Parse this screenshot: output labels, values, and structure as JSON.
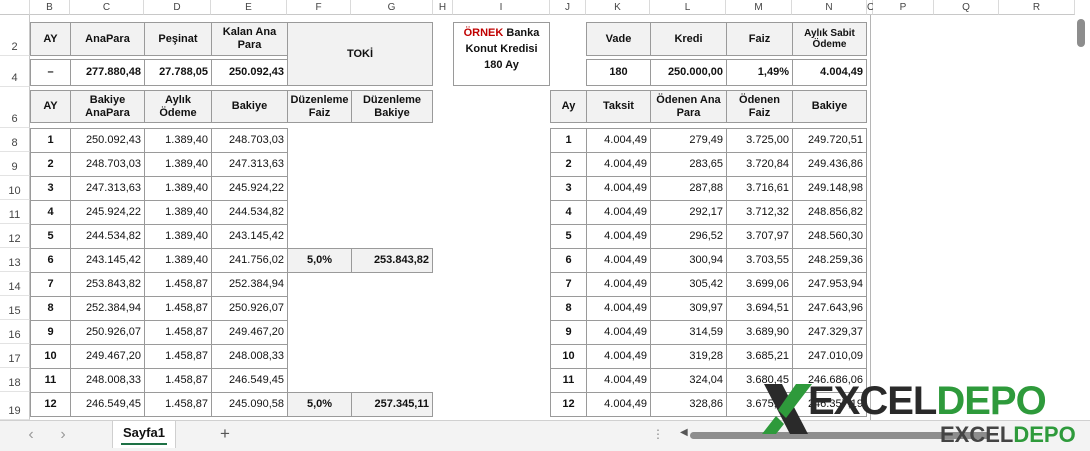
{
  "columns": [
    "B",
    "C",
    "D",
    "E",
    "F",
    "G",
    "H",
    "I",
    "J",
    "K",
    "L",
    "M",
    "N",
    "O",
    "P",
    "Q",
    "R"
  ],
  "rows": [
    "2",
    "4",
    "6",
    "8",
    "9",
    "10",
    "11",
    "12",
    "13",
    "14",
    "15",
    "16",
    "17",
    "18",
    "19"
  ],
  "left_summary": {
    "headers": [
      "AY",
      "AnaPara",
      "Peşinat",
      "Kalan Ana Para"
    ],
    "values": [
      "–",
      "277.880,48",
      "27.788,05",
      "250.092,43"
    ],
    "toki_label": "TOKİ"
  },
  "ornek": {
    "red": "ÖRNEK",
    "line1_rest": "Banka",
    "line2": "Konut Kredisi",
    "line3": "180 Ay"
  },
  "right_summary": {
    "headers": [
      "Vade",
      "Kredi",
      "Faiz",
      "Aylık Sabit Ödeme"
    ],
    "values": [
      "180",
      "250.000,00",
      "1,49%",
      "4.004,49"
    ]
  },
  "left_table": {
    "headers": [
      "AY",
      "Bakiye AnaPara",
      "Aylık Ödeme",
      "Bakiye",
      "Düzenleme Faiz",
      "Düzenleme Bakiye"
    ],
    "rows": [
      [
        "1",
        "250.092,43",
        "1.389,40",
        "248.703,03",
        "",
        ""
      ],
      [
        "2",
        "248.703,03",
        "1.389,40",
        "247.313,63",
        "",
        ""
      ],
      [
        "3",
        "247.313,63",
        "1.389,40",
        "245.924,22",
        "",
        ""
      ],
      [
        "4",
        "245.924,22",
        "1.389,40",
        "244.534,82",
        "",
        ""
      ],
      [
        "5",
        "244.534,82",
        "1.389,40",
        "243.145,42",
        "",
        ""
      ],
      [
        "6",
        "243.145,42",
        "1.389,40",
        "241.756,02",
        "5,0%",
        "253.843,82"
      ],
      [
        "7",
        "253.843,82",
        "1.458,87",
        "252.384,94",
        "",
        ""
      ],
      [
        "8",
        "252.384,94",
        "1.458,87",
        "250.926,07",
        "",
        ""
      ],
      [
        "9",
        "250.926,07",
        "1.458,87",
        "249.467,20",
        "",
        ""
      ],
      [
        "10",
        "249.467,20",
        "1.458,87",
        "248.008,33",
        "",
        ""
      ],
      [
        "11",
        "248.008,33",
        "1.458,87",
        "246.549,45",
        "",
        ""
      ],
      [
        "12",
        "246.549,45",
        "1.458,87",
        "245.090,58",
        "5,0%",
        "257.345,11"
      ]
    ]
  },
  "right_table": {
    "headers": [
      "Ay",
      "Taksit",
      "Ödenen Ana Para",
      "Ödenen Faiz",
      "Bakiye"
    ],
    "rows": [
      [
        "1",
        "4.004,49",
        "279,49",
        "3.725,00",
        "249.720,51"
      ],
      [
        "2",
        "4.004,49",
        "283,65",
        "3.720,84",
        "249.436,86"
      ],
      [
        "3",
        "4.004,49",
        "287,88",
        "3.716,61",
        "249.148,98"
      ],
      [
        "4",
        "4.004,49",
        "292,17",
        "3.712,32",
        "248.856,82"
      ],
      [
        "5",
        "4.004,49",
        "296,52",
        "3.707,97",
        "248.560,30"
      ],
      [
        "6",
        "4.004,49",
        "300,94",
        "3.703,55",
        "248.259,36"
      ],
      [
        "7",
        "4.004,49",
        "305,42",
        "3.699,06",
        "247.953,94"
      ],
      [
        "8",
        "4.004,49",
        "309,97",
        "3.694,51",
        "247.643,96"
      ],
      [
        "9",
        "4.004,49",
        "314,59",
        "3.689,90",
        "247.329,37"
      ],
      [
        "10",
        "4.004,49",
        "319,28",
        "3.685,21",
        "247.010,09"
      ],
      [
        "11",
        "4.004,49",
        "324,04",
        "3.680,45",
        "246.686,06"
      ],
      [
        "12",
        "4.004,49",
        "328,86",
        "3.675,63",
        "246.357,19"
      ]
    ]
  },
  "sheet_tab": "Sayfa1",
  "add_sheet": "+",
  "nav": {
    "prev": "‹",
    "next": "›"
  },
  "logo": {
    "big_a": "EXCEL",
    "big_b": "DEPO",
    "small_a": "EXCEL",
    "small_b": "DEPO"
  },
  "colors": {
    "accent_red": "#c00000",
    "tab_green": "#1e7145",
    "header_fill": "#f2f2f2"
  }
}
